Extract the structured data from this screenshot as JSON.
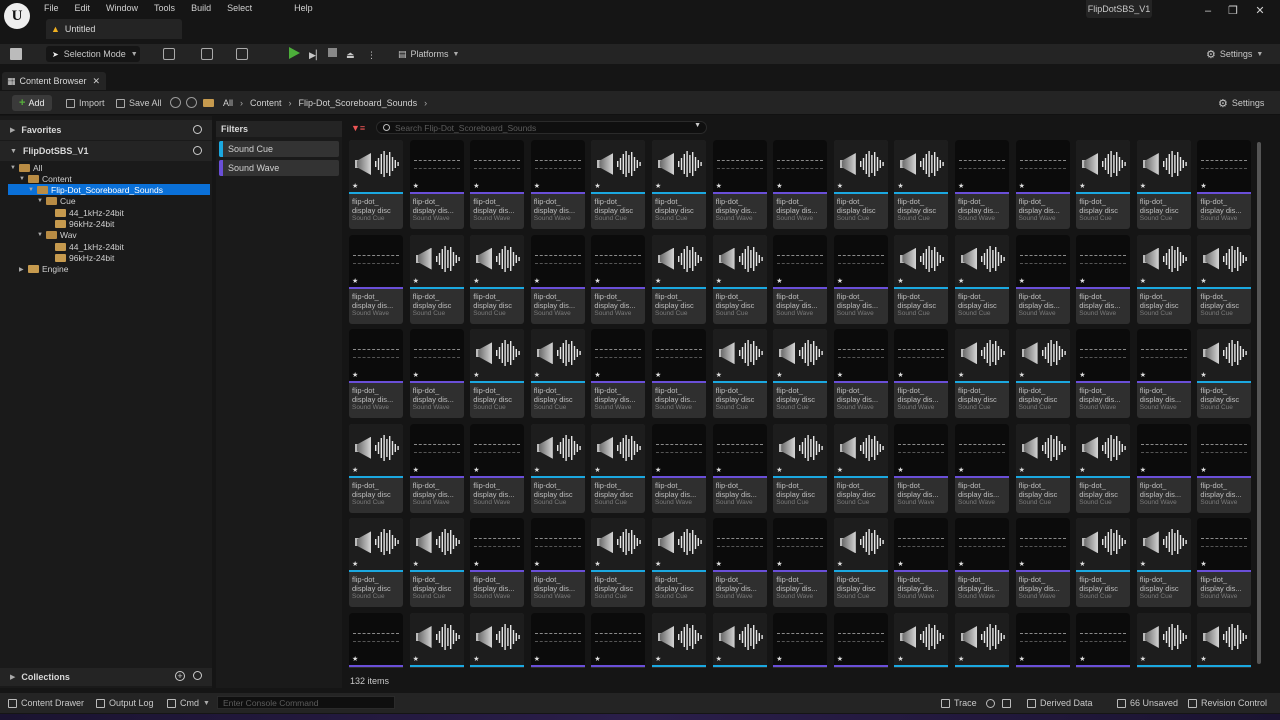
{
  "menu": [
    "File",
    "Edit",
    "Window",
    "Tools",
    "Build",
    "Select",
    "Help"
  ],
  "document_tab": "Untitled",
  "project_name": "FlipDotSBS_V1",
  "toolbar": {
    "selection_mode": "Selection Mode",
    "platforms": "Platforms",
    "settings": "Settings"
  },
  "content_browser": {
    "tab_label": "Content Browser",
    "add": "Add",
    "import": "Import",
    "save_all": "Save All",
    "breadcrumb": [
      "All",
      "Content",
      "Flip-Dot_Scoreboard_Sounds"
    ],
    "settings": "Settings"
  },
  "sources": {
    "favorites": "Favorites",
    "project_root": "FlipDotSBS_V1",
    "tree": [
      {
        "label": "All",
        "depth": 0,
        "expanded": true
      },
      {
        "label": "Content",
        "depth": 1,
        "expanded": true
      },
      {
        "label": "Flip-Dot_Scoreboard_Sounds",
        "depth": 2,
        "expanded": true,
        "selected": true
      },
      {
        "label": "Cue",
        "depth": 3,
        "expanded": true
      },
      {
        "label": "44_1kHz-24bit",
        "depth": 4
      },
      {
        "label": "96kHz-24bit",
        "depth": 4
      },
      {
        "label": "Wav",
        "depth": 3,
        "expanded": true
      },
      {
        "label": "44_1kHz-24bit",
        "depth": 4
      },
      {
        "label": "96kHz-24bit",
        "depth": 4
      },
      {
        "label": "Engine",
        "depth": 1,
        "expanded": false
      }
    ],
    "collections": "Collections"
  },
  "filters": {
    "title": "Filters",
    "items": [
      {
        "label": "Sound Cue",
        "color": "#1ba8e0"
      },
      {
        "label": "Sound Wave",
        "color": "#6a4fd8"
      }
    ]
  },
  "search": {
    "placeholder": "Search Flip-Dot_Scoreboard_Sounds"
  },
  "assets": {
    "name_line1": "flip-dot_",
    "name_line2_cue": "display disc",
    "name_line2_wave": "display dis...",
    "type_cue": "Sound Cue",
    "type_wave": "Sound Wave",
    "grid": [
      [
        "c",
        "w",
        "w",
        "w",
        "c",
        "c",
        "w",
        "w",
        "c",
        "c",
        "w",
        "w",
        "c",
        "c",
        "w"
      ],
      [
        "w",
        "c",
        "c",
        "w",
        "w",
        "c",
        "c",
        "w",
        "w",
        "c",
        "c",
        "w",
        "w",
        "c",
        "c"
      ],
      [
        "w",
        "w",
        "c",
        "c",
        "w",
        "w",
        "c",
        "c",
        "w",
        "w",
        "c",
        "c",
        "w",
        "w",
        "c"
      ],
      [
        "c",
        "w",
        "w",
        "c",
        "c",
        "w",
        "w",
        "c",
        "c",
        "w",
        "w",
        "c",
        "c",
        "w",
        "w"
      ],
      [
        "c",
        "c",
        "w",
        "w",
        "c",
        "c",
        "w",
        "w",
        "c",
        "w",
        "w",
        "w",
        "c",
        "c",
        "w"
      ],
      [
        "w",
        "c",
        "c",
        "w",
        "w",
        "c",
        "c",
        "w",
        "w",
        "c",
        "c",
        "w",
        "w",
        "c",
        "c"
      ]
    ],
    "count": "132 items"
  },
  "statusbar": {
    "content_drawer": "Content Drawer",
    "output_log": "Output Log",
    "cmd": "Cmd",
    "console_placeholder": "Enter Console Command",
    "trace": "Trace",
    "derived_data": "Derived Data",
    "unsaved": "66 Unsaved",
    "revision_control": "Revision Control"
  },
  "colors": {
    "accent": "#0a70d8",
    "sound_cue": "#1ba8e0",
    "sound_wave": "#6a4fd8",
    "play": "#4cae3a"
  }
}
